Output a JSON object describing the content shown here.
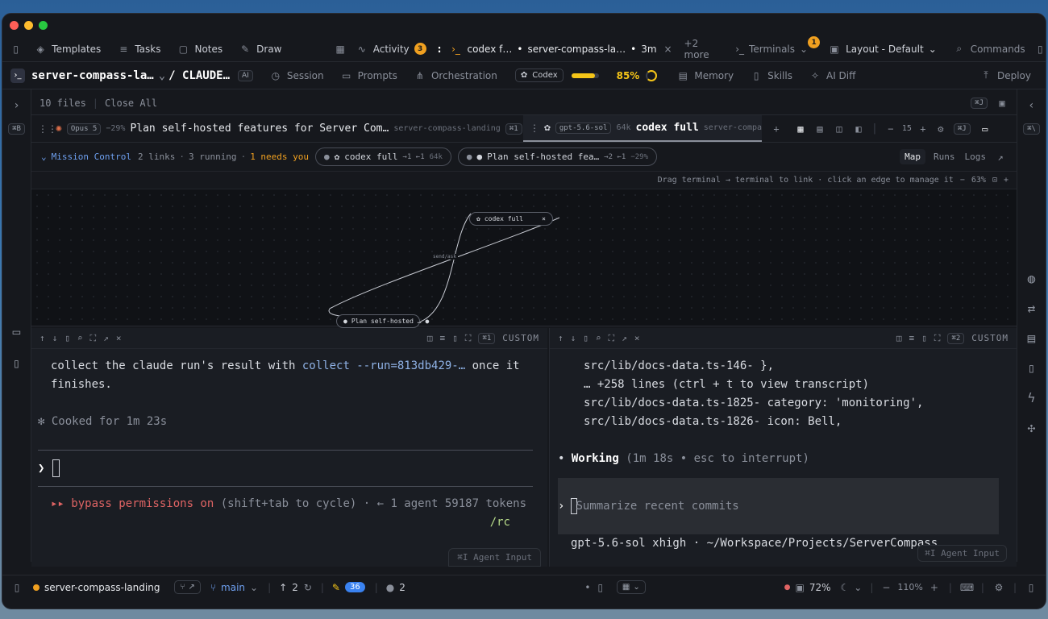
{
  "topbar": {
    "templates": "Templates",
    "tasks": "Tasks",
    "notes": "Notes",
    "draw": "Draw",
    "activity": "Activity",
    "activity_count": "3",
    "session_tab_a": "codex f…",
    "session_tab_b": "server-compass-la…",
    "session_tab_b_time": "3m",
    "more": "+2 more",
    "terminals": "Terminals",
    "terminals_count": "1",
    "layout": "Layout - Default",
    "commands": "Commands"
  },
  "projbar": {
    "project": "server-compass-la…",
    "path": "/ CLAUDE…",
    "ai_badge": "AI",
    "session": "Session",
    "prompts": "Prompts",
    "orchestration": "Orchestration",
    "codex": "Codex",
    "usage": "85%",
    "usage_fraction": 0.85,
    "memory": "Memory",
    "skills": "Skills",
    "ai_diff": "AI Diff",
    "deploy": "Deploy"
  },
  "rail": {
    "shortcut_left": "⌘B",
    "shortcut_right": "⌘\\"
  },
  "files": {
    "count": "10 files",
    "close_all": "Close All",
    "shortcut": "⌘J"
  },
  "tabs": [
    {
      "model": "Opus 5",
      "delta": "−29%",
      "title": "Plan self-hosted features for Server Com…",
      "project": "server-compass-landing",
      "kbd": "⌘1"
    },
    {
      "model": "gpt-5.6-sol",
      "tokens": "64k",
      "title": "codex full",
      "project": "server-compass-"
    }
  ],
  "tabs_controls": {
    "size": "15",
    "shortcut": "⌘J"
  },
  "mission": {
    "label": "Mission Control",
    "links": "2 links",
    "running": "3 running",
    "needs": "1 needs you",
    "pill1_title": "codex full",
    "pill1_stats": "→1 ←1",
    "pill1_tokens": "64k",
    "pill2_title": "Plan self-hosted fea…",
    "pill2_stats": "→2 ←1",
    "pill2_delta": "−29%",
    "map": "Map",
    "runs": "Runs",
    "logs": "Logs"
  },
  "hint": {
    "text": "Drag terminal → terminal to link · click an edge to manage it",
    "zoom": "63%"
  },
  "map": {
    "node_top": "codex full",
    "node_bottom": "Plan self-hosted …",
    "edge_label": "send/ask"
  },
  "term_left": {
    "custom": "CUSTOM",
    "kbd": "⌘1",
    "line1_a": "collect the claude run's result with ",
    "line1_cmd": "collect --run=813db429-…",
    "line1_b": " once it",
    "line2": "finishes.",
    "cooked": "✻ Cooked for 1m 23s",
    "prompt": "❯",
    "bypass_a": "▸▸ bypass permissions on",
    "bypass_b": " (shift+tab to cycle) · ← 1 agent 59187 tokens",
    "rc": "/rc",
    "agent_input": "⌘I  Agent Input"
  },
  "term_right": {
    "custom": "CUSTOM",
    "kbd": "⌘2",
    "l1": "src/lib/docs-data.ts-146-  },",
    "l2": "… +258 lines (ctrl + t to view transcript)",
    "l3": "src/lib/docs-data.ts-1825-    category: 'monitoring',",
    "l4": "src/lib/docs-data.ts-1826-    icon: Bell,",
    "working_b": "Working",
    "working_rest": " (1m 18s • esc to interrupt)",
    "input_text": "Summarize recent commits",
    "model_line": "gpt-5.6-sol xhigh · ~/Workspace/Projects/ServerCompass",
    "agent_input": "⌘I  Agent Input"
  },
  "status": {
    "project": "server-compass-landing",
    "branch": "main",
    "ahead": "2",
    "edits": "36",
    "count": "2",
    "cpu": "72%",
    "zoom": "110%"
  },
  "colors": {
    "accent_orange": "#f0a020",
    "accent_blue": "#3a82f0",
    "danger": "#e06464",
    "usage_bar": "#f5c518"
  }
}
